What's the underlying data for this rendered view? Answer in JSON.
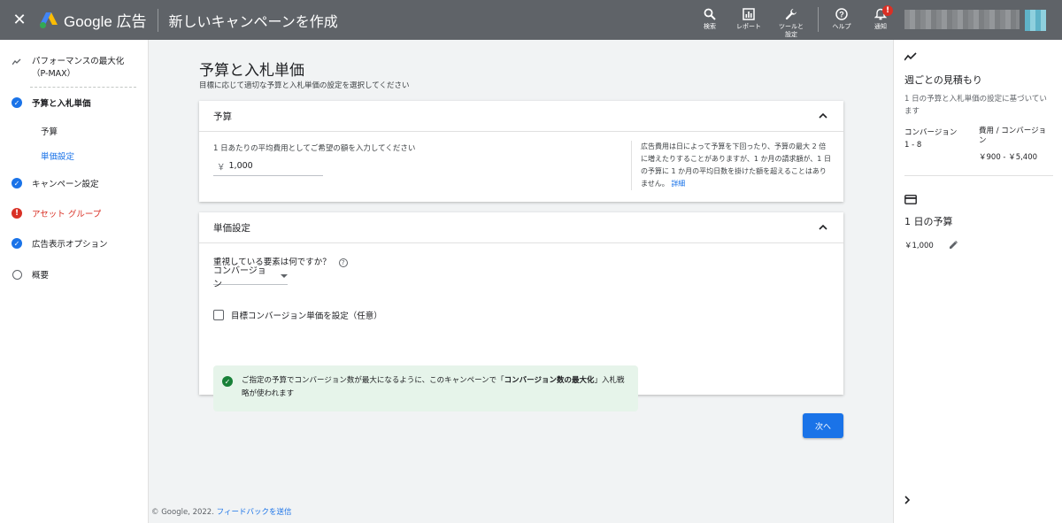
{
  "topbar": {
    "close": "✕",
    "brand": "Google 広告",
    "title": "新しいキャンペーンを作成",
    "actions": {
      "search": "検索",
      "report": "レポート",
      "tools": "ツールと設定",
      "help": "ヘルプ",
      "notify": "通知",
      "notify_badge": "!"
    }
  },
  "leftnav": {
    "pmax": "パフォーマンスの最大化（P-MAX）",
    "budget_bid": "予算と入札単価",
    "sub_budget": "予算",
    "sub_bid": "単価設定",
    "campaign_settings": "キャンペーン設定",
    "asset_group": "アセット グループ",
    "ad_extensions": "広告表示オプション",
    "summary": "概要"
  },
  "main": {
    "title": "予算と入札単価",
    "subtitle": "目標に応じて適切な予算と入札単価の設定を選択してください",
    "budget_card": {
      "header": "予算",
      "field_label": "1 日あたりの平均費用としてご希望の額を入力してください",
      "currency": "￥",
      "value": "1,000",
      "note": "広告費用は日によって予算を下回ったり、予算の最大 2 倍に増えたりすることがありますが、1 か月の請求額が、1 日の予算に 1 か月の平均日数を掛けた額を超えることはありません。",
      "note_link": "詳細"
    },
    "bid_card": {
      "header": "単価設定",
      "question": "重視している要素は何ですか？",
      "dropdown_value": "コンバージョン",
      "checkbox_label": "目標コンバージョン単価を設定（任意）",
      "info_text_1": "ご指定の予算でコンバージョン数が最大になるように、このキャンペーンで「",
      "info_bold": "コンバージョン数の最大化",
      "info_text_2": "」入札戦略が使われます"
    },
    "next_button": "次へ",
    "footer_text": "© Google, 2022.",
    "footer_link": "フィードバックを送信"
  },
  "rightpanel": {
    "weekly_title": "週ごとの見積もり",
    "weekly_desc": "1 日の予算と入札単価の設定に基づいています",
    "conv_label": "コンバージョン",
    "conv_value": "1 - 8",
    "cost_label": "費用 / コンバージョン",
    "cost_value": "￥900 - ￥5,400",
    "daily_title": "1 日の予算",
    "daily_value": "￥1,000"
  },
  "colors": {
    "topbar": "#5f6368",
    "accent": "#1a73e8",
    "error": "#d93025",
    "success_bg": "#e6f4ea",
    "success": "#188038"
  }
}
